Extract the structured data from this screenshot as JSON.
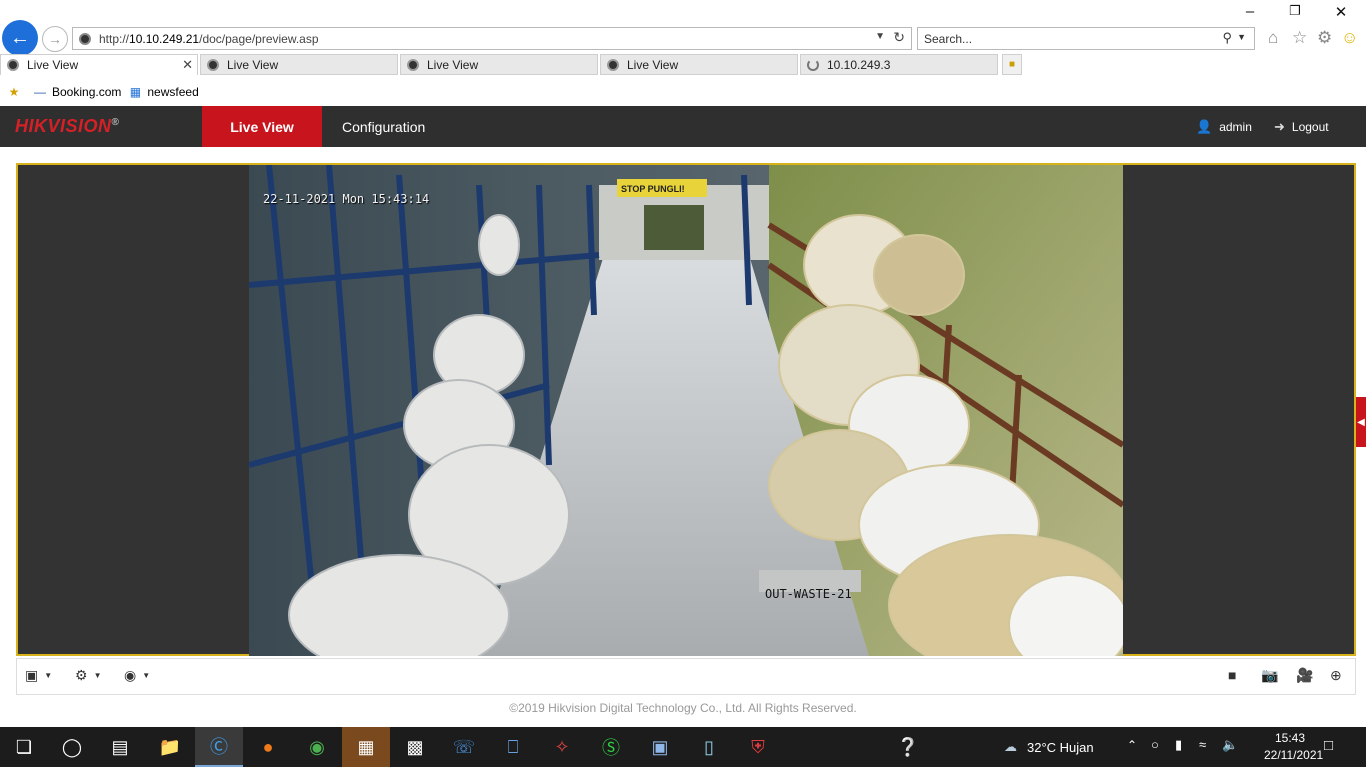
{
  "browser": {
    "url_prefix": "http://",
    "url_host": "10.10.249.21",
    "url_path": "/doc/page/preview.asp",
    "search_placeholder": "Search...",
    "tabs": [
      {
        "label": "Live View",
        "active": true
      },
      {
        "label": "Live View",
        "active": false
      },
      {
        "label": "Live View",
        "active": false
      },
      {
        "label": "Live View",
        "active": false
      },
      {
        "label": "10.10.249.3",
        "active": false,
        "loading": true
      }
    ],
    "favorites": [
      {
        "label": "Booking.com"
      },
      {
        "label": "newsfeed"
      }
    ]
  },
  "header": {
    "logo": "HIKVISION",
    "logo_mark": "®",
    "menu_live": "Live View",
    "menu_config": "Configuration",
    "user": "admin",
    "logout": "Logout"
  },
  "video": {
    "osd_time": "22-11-2021 Mon 15:43:14",
    "osd_name": "OUT-WASTE-21",
    "sign_text": "STOP PUNGLI!"
  },
  "footer": {
    "copyright": "©2019 Hikvision Digital Technology Co., Ltd. All Rights Reserved."
  },
  "taskbar": {
    "weather": "32°C  Hujan",
    "time": "15:43",
    "date": "22/11/2021"
  },
  "colors": {
    "hik_red": "#c8151d",
    "header_bg": "#2f2f2f",
    "viewport_border": "#d8b21a",
    "ie_blue": "#1e6fd9"
  }
}
